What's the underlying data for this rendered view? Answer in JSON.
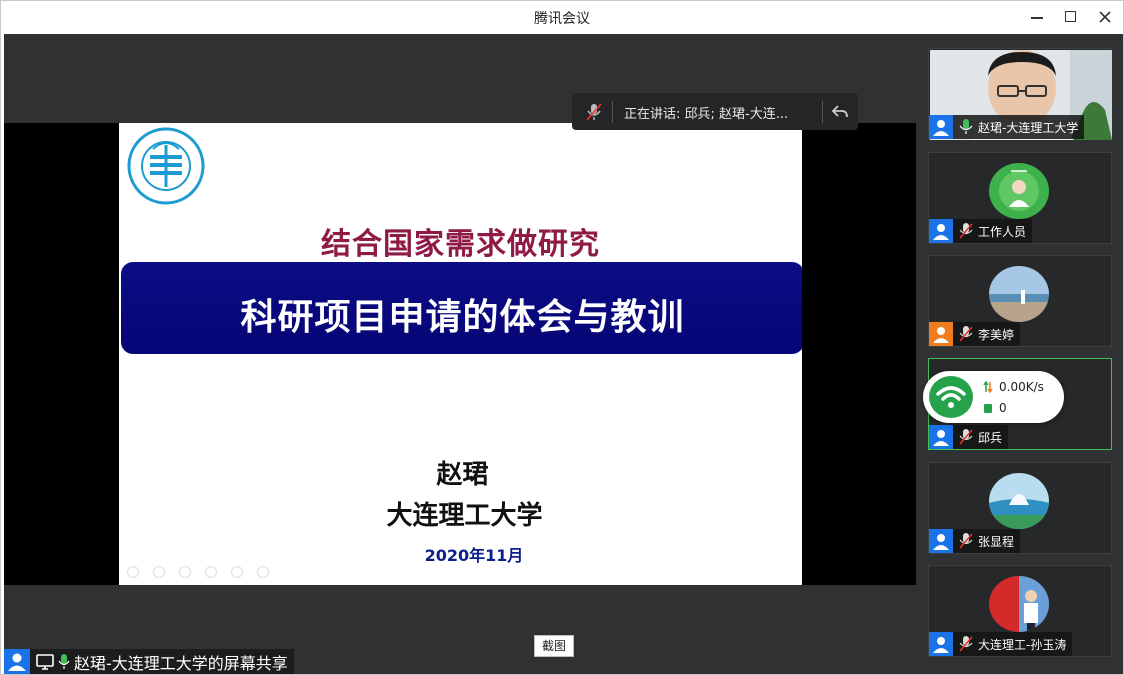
{
  "window": {
    "title": "腾讯会议"
  },
  "slide": {
    "heading": "结合国家需求做研究",
    "banner": "科研项目申请的体会与教训",
    "author": "赵珺",
    "university": "大连理工大学",
    "date": "2020年11月"
  },
  "speaking": {
    "text": "正在讲话: 邱兵; 赵珺-大连..."
  },
  "screenshot_button": "截图",
  "share_label": "赵珺-大连理工大学的屏幕共享",
  "participants": [
    {
      "name": "赵珺-大连理工大学",
      "mic": "on",
      "badge": "#1a73e8"
    },
    {
      "name": "工作人员",
      "mic": "muted",
      "badge": "#1a73e8"
    },
    {
      "name": "李美婷",
      "mic": "muted",
      "badge": "#f07c1e"
    },
    {
      "name": "邱兵",
      "mic": "muted",
      "badge": "#1a73e8"
    },
    {
      "name": "张显程",
      "mic": "muted",
      "badge": "#1a73e8"
    },
    {
      "name": "大连理工-孙玉涛",
      "mic": "muted",
      "badge": "#1a73e8"
    }
  ],
  "network": {
    "speed": "0.00K/s",
    "loss": "0"
  },
  "colors": {
    "accent": "#1a73e8",
    "active_border": "#3fbf54",
    "heading": "#8e1a45",
    "banner": "#0d0d85"
  }
}
